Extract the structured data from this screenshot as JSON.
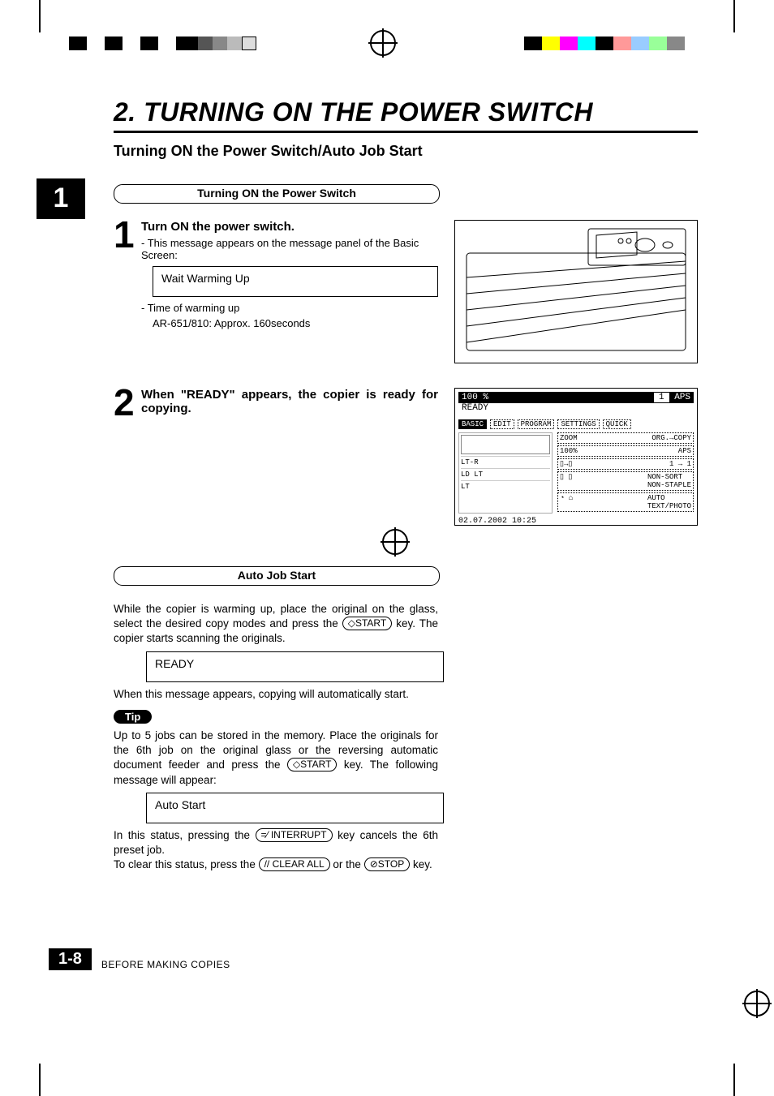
{
  "chapter": {
    "number": "1",
    "title": "2. TURNING ON THE POWER SWITCH",
    "subtitle": "Turning ON the Power Switch/Auto Job Start"
  },
  "section1": {
    "pill": "Turning ON the Power Switch",
    "step1": {
      "num": "1",
      "head": "Turn ON the power switch.",
      "note": "- This message appears on the message panel of the Basic Screen:",
      "msg": "Wait  Warming Up",
      "time1": "- Time of warming up",
      "time2": "AR-651/810: Approx. 160seconds"
    },
    "step2": {
      "num": "2",
      "head": "When \"READY\" appears, the copier is ready for copying."
    }
  },
  "screen": {
    "zoom": "100  %",
    "qty": "1",
    "mode": "APS",
    "ready": "READY",
    "tabs": [
      "BASIC",
      "EDIT",
      "PROGRAM",
      "SETTINGS",
      "QUICK"
    ],
    "trays": [
      "LT-R",
      "LD        LT",
      "LT"
    ],
    "opts": [
      {
        "l": "ZOOM",
        "r": "ORG.→COPY"
      },
      {
        "l": "100%",
        "r": "APS"
      },
      {
        "l": "▯→▯",
        "r": "1 → 1"
      },
      {
        "l": "▯ ▯",
        "r": "NON-SORT\nNON-STAPLE"
      },
      {
        "l": "◔ ⌂",
        "r": "AUTO\nTEXT/PHOTO"
      }
    ],
    "date": "02.07.2002 10:25"
  },
  "section2": {
    "pill": "Auto Job Start",
    "p1a": "While the copier is warming up, place the original on the glass, select the desired copy modes and press the ",
    "key_start": "◇START",
    "p1b": " key. The copier starts scanning the originals.",
    "msg_ready": "READY",
    "p2": "When this message appears, copying will automatically start.",
    "tip_label": "Tip",
    "p3a": "Up to 5 jobs can be stored in the memory. Place the originals for the 6th job on the original glass or the reversing automatic document feeder and press the ",
    "p3b": " key. The following message will appear:",
    "msg_auto": "Auto Start",
    "p4a": "In this status, pressing the ",
    "key_interrupt": "=⁄ INTERRUPT",
    "p4b": " key cancels the 6th preset job.",
    "p5a": "To clear this status, press the ",
    "key_clear": "// CLEAR ALL",
    "p5b": " or the ",
    "key_stop": "⊘STOP",
    "p5c": " key."
  },
  "footer": {
    "page": "1-8",
    "text": "BEFORE MAKING COPIES"
  }
}
